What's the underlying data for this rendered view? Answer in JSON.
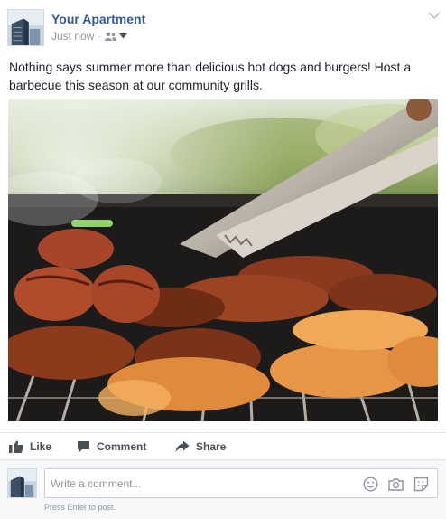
{
  "post": {
    "page_name": "Your Apartment",
    "timestamp": "Just now",
    "separator": "·",
    "audience_icon": "friends-icon",
    "text": "Nothing says summer more than delicious hot dogs and burgers! Host a barbecue this season at our community grills."
  },
  "actions": {
    "like_label": "Like",
    "comment_label": "Comment",
    "share_label": "Share"
  },
  "comment": {
    "placeholder": "Write a comment...",
    "hint": "Press Enter to post.",
    "icons": [
      "emoji-icon",
      "camera-icon",
      "sticker-icon"
    ]
  },
  "colors": {
    "link": "#365899",
    "meta": "#90949c",
    "action": "#4b4f56"
  }
}
